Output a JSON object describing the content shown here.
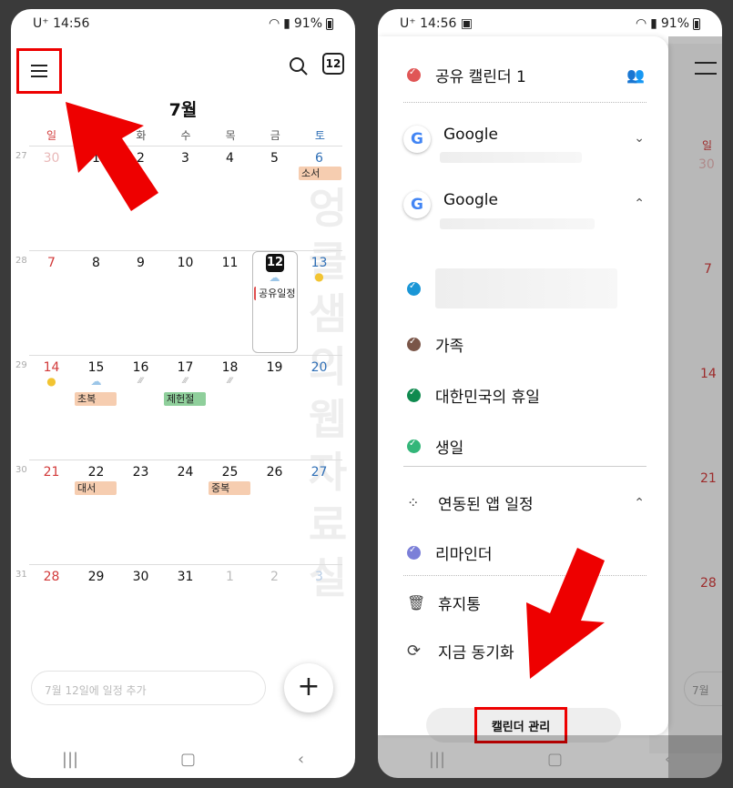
{
  "left": {
    "status": {
      "carrier": "U⁺",
      "time": "14:56",
      "battery": "91%"
    },
    "today_icon": "12",
    "month": "7월",
    "dow": [
      "일",
      "월",
      "화",
      "수",
      "목",
      "금",
      "토"
    ],
    "weeks": [
      {
        "num": "27",
        "days": [
          "30",
          "1",
          "2",
          "3",
          "4",
          "5",
          "6"
        ]
      },
      {
        "num": "28",
        "days": [
          "7",
          "8",
          "9",
          "10",
          "11",
          "12",
          "13"
        ]
      },
      {
        "num": "29",
        "days": [
          "14",
          "15",
          "16",
          "17",
          "18",
          "19",
          "20"
        ]
      },
      {
        "num": "30",
        "days": [
          "21",
          "22",
          "23",
          "24",
          "25",
          "26",
          "27"
        ]
      },
      {
        "num": "31",
        "days": [
          "28",
          "29",
          "30",
          "31",
          "1",
          "2",
          "3"
        ]
      }
    ],
    "events": {
      "soseo": "소서",
      "shared": "공유일정",
      "chobok": "초복",
      "jeheonjeol": "제헌절",
      "daeseo": "대서",
      "jungbok": "중복"
    },
    "watermark": "엉클샘의웹자료실",
    "add_placeholder": "7월 12일에 일정 추가",
    "fab": "+",
    "colors": {
      "sunday": "#d23a3a",
      "saturday": "#2f6fb6",
      "event": "#f6cdb0",
      "event_green": "#8fcf9b",
      "shared_bar": "#e05050"
    }
  },
  "right": {
    "status": {
      "carrier": "U⁺",
      "time": "14:56",
      "battery": "91%"
    },
    "shared_calendar": "공유 캘린더 1",
    "google1": "Google",
    "google2": "Google",
    "family": "가족",
    "holiday": "대한민국의 휴일",
    "birthday": "생일",
    "linked_apps": "연동된 앱 일정",
    "reminder": "리마인더",
    "trash": "휴지통",
    "sync": "지금 동기화",
    "manage": "캘린더 관리",
    "bg": {
      "sun": "일",
      "d30": "30",
      "d7": "7",
      "d14": "14",
      "d21": "21",
      "d28": "28",
      "placeholder": "7월"
    },
    "colors": {
      "shared": "#e05656",
      "google_sub": "#1a96d6",
      "family": "#7a5548",
      "holiday": "#0f8a4f",
      "birthday": "#33b679",
      "reminder": "#7b7fd8"
    }
  }
}
